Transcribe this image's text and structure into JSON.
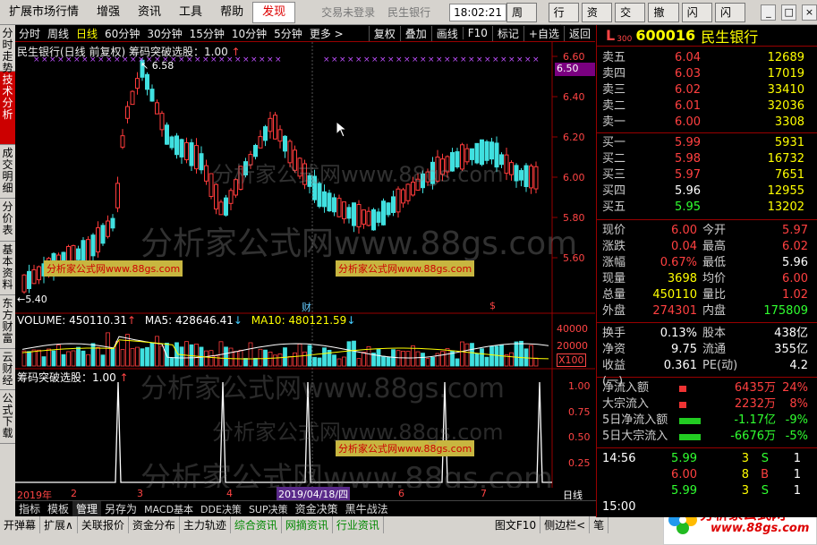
{
  "menu": {
    "items": [
      "扩展市场行情",
      "增强",
      "资讯",
      "工具",
      "帮助"
    ],
    "active": "发现",
    "status1": "交易未登录",
    "status2": "民生银行",
    "clock": "18:02:21",
    "weekday": "周日",
    "buttons": [
      "行情",
      "资讯",
      "交易",
      "撤单",
      "闪卖",
      "闪买"
    ]
  },
  "left_tabs": [
    "分时走势",
    "技术分析",
    "成交明细",
    "分价表",
    "基本资料",
    "东方财富",
    "云财经",
    "公式下载"
  ],
  "period_tabs": [
    "分时",
    "周线",
    "日线",
    "60分钟",
    "30分钟",
    "15分钟",
    "10分钟",
    "5分钟",
    "更多 >"
  ],
  "period_active": "日线",
  "tools": [
    "复权",
    "叠加",
    "画线",
    "F10",
    "标记",
    "+自选",
    "返回"
  ],
  "chart": {
    "main_title": "民生银行(日线 前复权) 筹码突破选股：1.00",
    "max_price": "6.58",
    "min_price": "5.40",
    "current_tag": "6.50",
    "vol_label": "VOLUME: 450110.31",
    "ma5_label": "MA5: 428646.41",
    "ma10_label": "MA10: 480121.59",
    "ind_title": "筹码突破选股：1.00",
    "fin_marker": "财",
    "s_marker": "$",
    "ad_text": "分析家公式网www.88gs.com",
    "watermark": "分析家公式网www.88gs.com",
    "price_axis": [
      "6.60",
      "6.40",
      "6.20",
      "6.00",
      "5.80",
      "5.60"
    ],
    "vol_axis": [
      "40000",
      "20000",
      "X100"
    ],
    "ind_axis": [
      "1.00",
      "0.75",
      "0.50",
      "0.25"
    ],
    "date_axis": [
      "2019年",
      "2",
      "3",
      "4",
      "2019/04/18/四",
      "6",
      "7"
    ],
    "period_label": "日线"
  },
  "chart_data": {
    "type": "candlestick",
    "price_range": [
      5.35,
      6.65
    ],
    "hi_value": 6.58,
    "lo_value": 5.4,
    "last_price": 6.0,
    "volume_axis_max": 40000
  },
  "stock": {
    "flag": "L",
    "rank": "300",
    "code": "600016",
    "name": "民生银行"
  },
  "orderbook": {
    "asks": [
      {
        "label": "卖五",
        "price": "6.04",
        "vol": "12689"
      },
      {
        "label": "卖四",
        "price": "6.03",
        "vol": "17019"
      },
      {
        "label": "卖三",
        "price": "6.02",
        "vol": "33410"
      },
      {
        "label": "卖二",
        "price": "6.01",
        "vol": "32036"
      },
      {
        "label": "卖一",
        "price": "6.00",
        "vol": "3308"
      }
    ],
    "bids": [
      {
        "label": "买一",
        "price": "5.99",
        "vol": "5931"
      },
      {
        "label": "买二",
        "price": "5.98",
        "vol": "16732"
      },
      {
        "label": "买三",
        "price": "5.97",
        "vol": "7651"
      },
      {
        "label": "买四",
        "price": "5.96",
        "vol": "12955"
      },
      {
        "label": "买五",
        "price": "5.95",
        "vol": "13202"
      }
    ]
  },
  "stats": [
    [
      "现价",
      "6.00",
      "今开",
      "5.97"
    ],
    [
      "涨跌",
      "0.04",
      "最高",
      "6.02"
    ],
    [
      "涨幅",
      "0.67%",
      "最低",
      "5.96"
    ],
    [
      "现量",
      "3698",
      "均价",
      "6.00"
    ],
    [
      "总量",
      "450110",
      "量比",
      "1.02"
    ],
    [
      "外盘",
      "274301",
      "内盘",
      "175809"
    ]
  ],
  "fundamentals": [
    [
      "换手",
      "0.13%",
      "股本",
      "438亿"
    ],
    [
      "净资",
      "9.75",
      "流通",
      "355亿"
    ],
    [
      "收益(一)",
      "0.361",
      "PE(动)",
      "4.2"
    ]
  ],
  "flows": [
    {
      "label": "净流入额",
      "value": "6435万",
      "pct": "24%",
      "dir": "up"
    },
    {
      "label": "大宗流入",
      "value": "2232万",
      "pct": "8%",
      "dir": "up"
    },
    {
      "label": "5日净流入额",
      "value": "-1.17亿",
      "pct": "-9%",
      "dir": "dn"
    },
    {
      "label": "5日大宗流入",
      "value": "-6676万",
      "pct": "-5%",
      "dir": "dn"
    }
  ],
  "ticks": [
    {
      "time": "14:56",
      "price": "5.99",
      "vol": "3",
      "side": "S",
      "n": "1"
    },
    {
      "time": "",
      "price": "6.00",
      "vol": "8",
      "side": "B",
      "n": "1"
    },
    {
      "time": "",
      "price": "5.99",
      "vol": "3",
      "side": "S",
      "n": "1"
    },
    {
      "time": "15:00",
      "price": "",
      "vol": "",
      "side": "",
      "n": ""
    }
  ],
  "bottom_tabs1": [
    "指标",
    "模板",
    "管理",
    "另存为",
    "MACD基本",
    "DDE决策",
    "SUP决策",
    "资金决策",
    "黑牛战法"
  ],
  "bottom_tabs1_active": "管理",
  "bottom_tabs2": [
    "开弹幕",
    "扩展∧",
    "关联报价",
    "资金分布",
    "主力轨迹",
    "综合资讯",
    "网摘资讯",
    "行业资讯",
    "图文F10",
    "侧边栏<",
    "笔"
  ],
  "logo_text": "分析家公式网",
  "logo_url": "www.88gs.com"
}
